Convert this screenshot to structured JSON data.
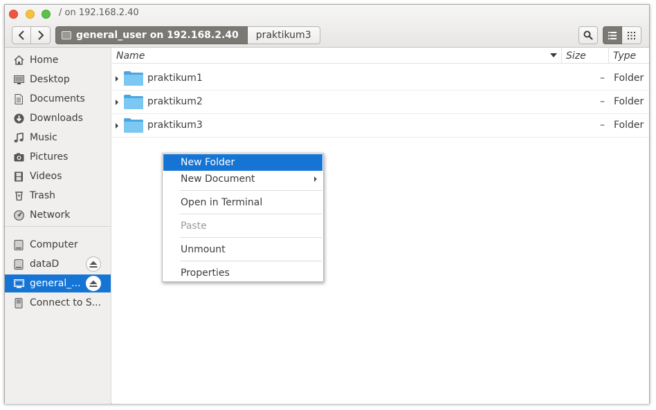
{
  "window": {
    "title": "/ on 192.168.2.40"
  },
  "pathbar": {
    "crumbs": [
      {
        "label": "general_user on 192.168.2.40",
        "icon": "network-drive-icon"
      },
      {
        "label": "praktikum3"
      }
    ]
  },
  "sidebar": {
    "places": [
      {
        "label": "Home",
        "icon": "home-icon"
      },
      {
        "label": "Desktop",
        "icon": "desktop-icon"
      },
      {
        "label": "Documents",
        "icon": "documents-icon"
      },
      {
        "label": "Downloads",
        "icon": "downloads-icon"
      },
      {
        "label": "Music",
        "icon": "music-icon"
      },
      {
        "label": "Pictures",
        "icon": "pictures-icon"
      },
      {
        "label": "Videos",
        "icon": "videos-icon"
      },
      {
        "label": "Trash",
        "icon": "trash-icon"
      },
      {
        "label": "Network",
        "icon": "network-icon"
      }
    ],
    "devices": [
      {
        "label": "Computer",
        "icon": "computer-icon"
      },
      {
        "label": "dataD",
        "icon": "drive-icon",
        "ejectable": true
      },
      {
        "label": "general_...",
        "icon": "network-drive-icon",
        "ejectable": true,
        "selected": true
      },
      {
        "label": "Connect to S...",
        "icon": "connect-server-icon"
      }
    ]
  },
  "file_list": {
    "columns": {
      "name": "Name",
      "size": "Size",
      "type": "Type"
    },
    "rows": [
      {
        "name": "praktikum1",
        "size": "–",
        "type": "Folder"
      },
      {
        "name": "praktikum2",
        "size": "–",
        "type": "Folder"
      },
      {
        "name": "praktikum3",
        "size": "–",
        "type": "Folder"
      }
    ]
  },
  "context_menu": {
    "items": [
      {
        "label": "New Folder",
        "state": "highlighted"
      },
      {
        "label": "New Document",
        "submenu": true
      },
      {
        "label": "Open in Terminal"
      },
      {
        "label": "Paste",
        "state": "disabled"
      },
      {
        "label": "Unmount"
      },
      {
        "label": "Properties"
      }
    ]
  },
  "colors": {
    "accent": "#1574d4",
    "folder": "#6cc0ef",
    "sidebar_bg": "#f0efed"
  }
}
